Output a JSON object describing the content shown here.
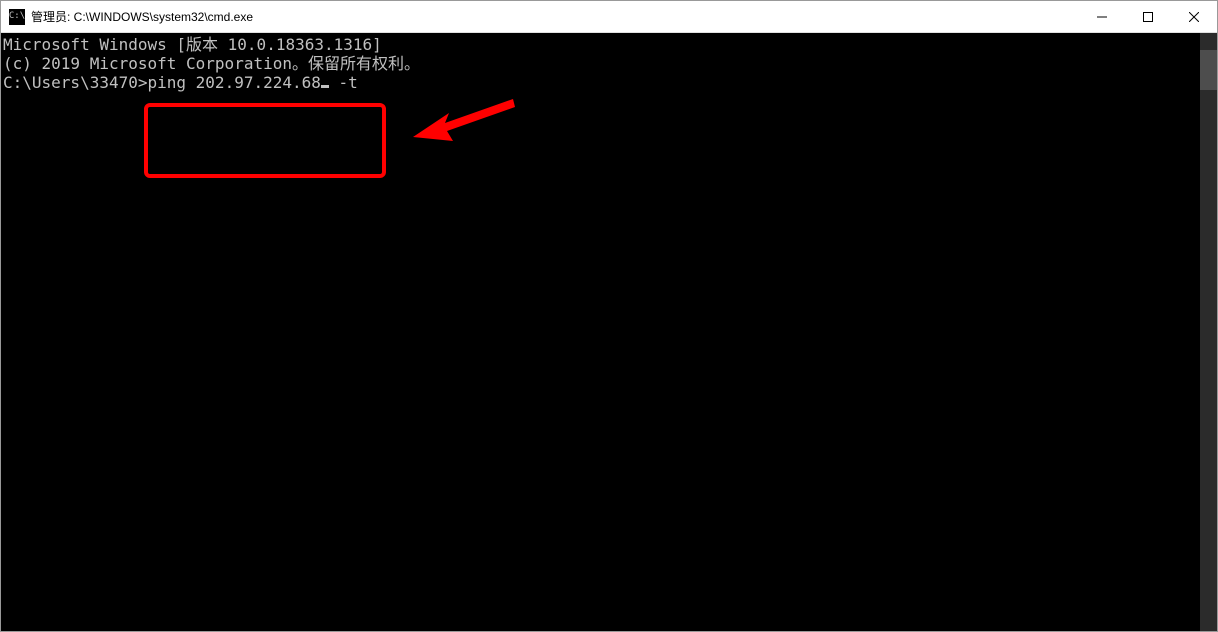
{
  "window": {
    "title": "管理员: C:\\WINDOWS\\system32\\cmd.exe"
  },
  "terminal": {
    "line1": "Microsoft Windows [版本 10.0.18363.1316]",
    "line2": "(c) 2019 Microsoft Corporation。保留所有权利。",
    "line3": "",
    "prompt": "C:\\Users\\33470>",
    "command_part1": "ping 202.97.224.68",
    "command_part2": " -t"
  },
  "annotation": {
    "highlight_color": "#ff0000",
    "arrow_color": "#ff0000"
  }
}
